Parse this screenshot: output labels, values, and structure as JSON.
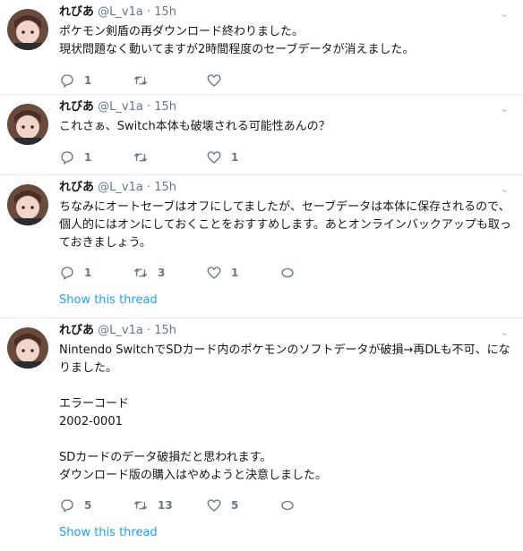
{
  "tweets": [
    {
      "name": "れびあ",
      "handle": "@L_v1a",
      "sep": "·",
      "time": "15h",
      "text": "ポケモン剣盾の再ダウンロード終わりました。\n現状問題なく動いてますが2時間程度のセーブデータが消えました。",
      "replies": "1",
      "retweets": "",
      "likes": "",
      "show_thread": ""
    },
    {
      "name": "れびあ",
      "handle": "@L_v1a",
      "sep": "·",
      "time": "15h",
      "text": "これさぁ、Switch本体も破壊される可能性あんの？",
      "replies": "1",
      "retweets": "",
      "likes": "1",
      "show_thread": ""
    },
    {
      "name": "れびあ",
      "handle": "@L_v1a",
      "sep": "·",
      "time": "15h",
      "text": "ちなみにオートセーブはオフにしてましたが、セーブデータは本体に保存されるので、個人的にはオンにしておくことをおすすめします。あとオンラインバックアップも取っておきましょう。",
      "replies": "1",
      "retweets": "3",
      "likes": "1",
      "show_thread": "Show this thread"
    },
    {
      "name": "れびあ",
      "handle": "@L_v1a",
      "sep": "·",
      "time": "15h",
      "text": "Nintendo SwitchでSDカード内のポケモンのソフトデータが破損→再DLも不可、になりました。\n\nエラーコード\n2002-0001\n\nSDカードのデータ破損だと思われます。\nダウンロード版の購入はやめようと決意しました。",
      "replies": "5",
      "retweets": "13",
      "likes": "5",
      "show_thread": "Show this thread"
    }
  ],
  "icons": {
    "reply": "reply-icon",
    "retweet": "retweet-icon",
    "like": "heart-icon",
    "message": "direct-message-icon",
    "caret": "chevron-down-icon"
  },
  "colors": {
    "link": "#1da1f2",
    "secondary": "#657786",
    "border": "#e6ecf0"
  }
}
